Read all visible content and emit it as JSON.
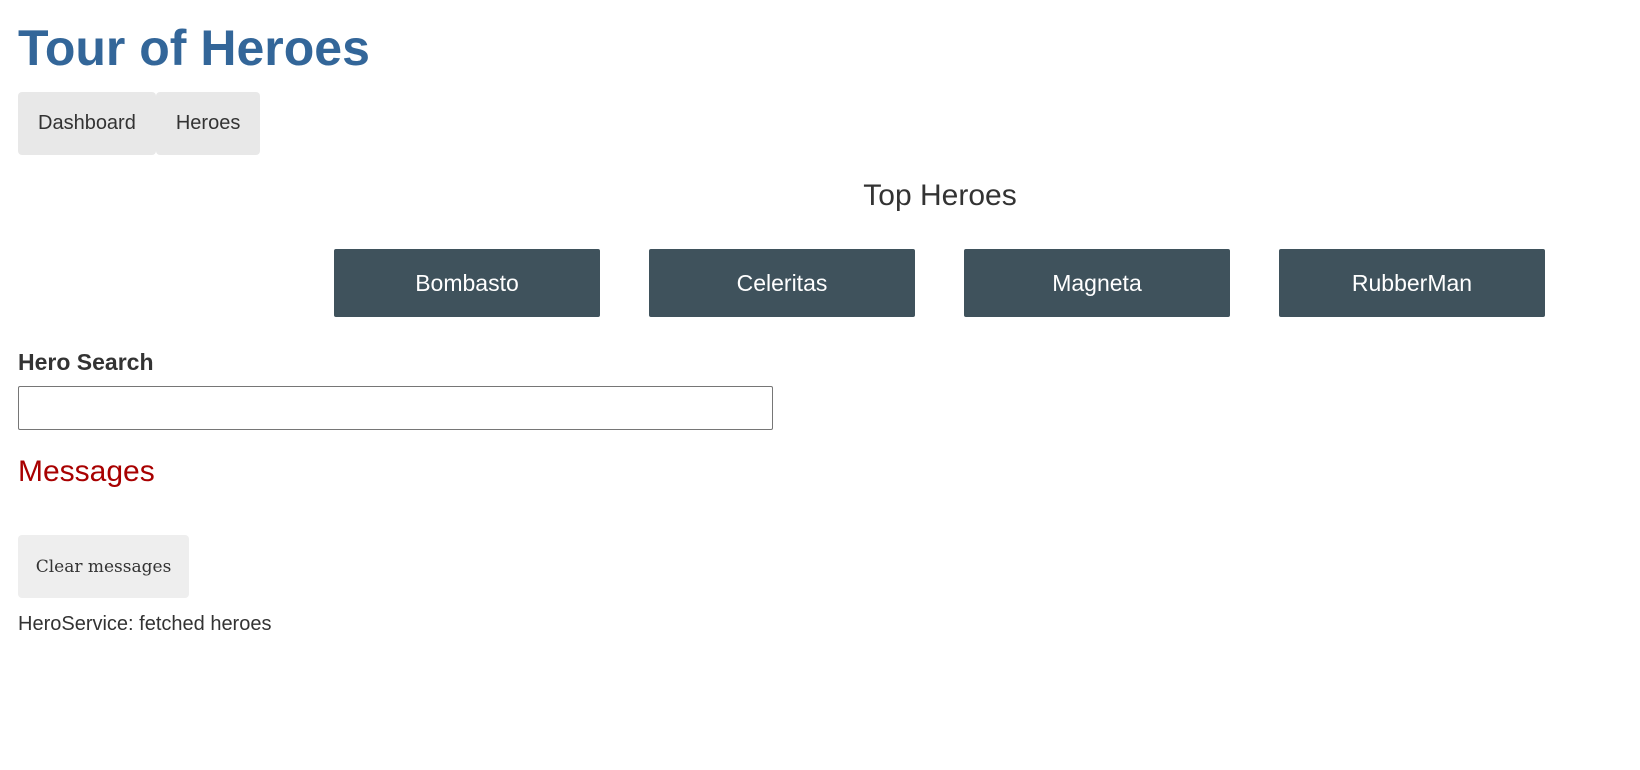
{
  "app": {
    "title": "Tour of Heroes"
  },
  "nav": {
    "items": [
      {
        "label": "Dashboard"
      },
      {
        "label": "Heroes"
      }
    ]
  },
  "dashboard": {
    "title": "Top Heroes",
    "heroes": [
      {
        "name": "Bombasto"
      },
      {
        "name": "Celeritas"
      },
      {
        "name": "Magneta"
      },
      {
        "name": "RubberMan"
      }
    ],
    "card_color": "#3f525c"
  },
  "search": {
    "label": "Hero Search",
    "value": ""
  },
  "messages": {
    "title": "Messages",
    "clear_label": "Clear messages",
    "items": [
      "HeroService: fetched heroes"
    ]
  },
  "colors": {
    "title": "#336699",
    "messages_title": "#a80000",
    "nav_background": "#e8e8e8"
  }
}
